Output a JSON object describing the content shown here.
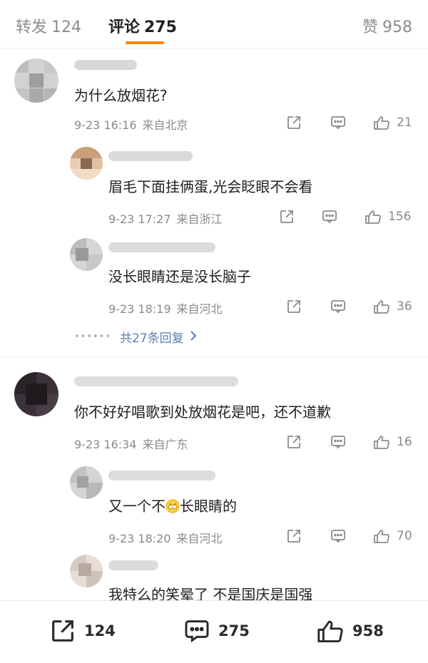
{
  "tabs": {
    "repost": {
      "label": "转发",
      "count": "124"
    },
    "comment": {
      "label": "评论",
      "count": "275"
    },
    "like": {
      "label": "赞",
      "count": "958"
    }
  },
  "comments": [
    {
      "text": "为什么放烟花?",
      "time": "9-23 16:16",
      "location": "来自北京",
      "likes": "21",
      "replies": [
        {
          "text": "眉毛下面挂俩蛋,光会眨眼不会看",
          "time": "9-23 17:27",
          "location": "来自浙江",
          "likes": "156"
        },
        {
          "text": "没长眼睛还是没长脑子",
          "time": "9-23 18:19",
          "location": "来自河北",
          "likes": "36"
        }
      ],
      "more_replies": "共27条回复"
    },
    {
      "text": "你不好好唱歌到处放烟花是吧，还不道歉",
      "time": "9-23 16:34",
      "location": "来自广东",
      "likes": "16",
      "replies": [
        {
          "text_before": "又一个不",
          "emoji": "grinning-face-icon",
          "text_after": "长眼睛的",
          "time": "9-23 18:20",
          "location": "来自河北",
          "likes": "70"
        },
        {
          "text": "我特么的笑晕了 不是国庆是国强"
        }
      ]
    }
  ],
  "bottom_bar": {
    "repost_count": "124",
    "comment_count": "275",
    "like_count": "958"
  },
  "colors": {
    "accent": "#ff8200",
    "link": "#5b7db2",
    "meta": "#8a8a8a"
  }
}
